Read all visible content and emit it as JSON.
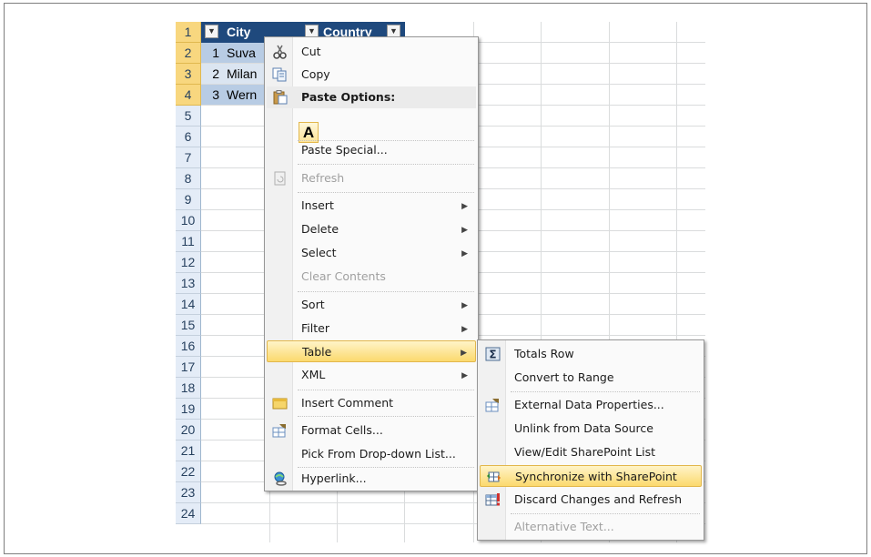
{
  "sheet": {
    "row_numbers": [
      "1",
      "2",
      "3",
      "4",
      "5",
      "6",
      "7",
      "8",
      "9",
      "10",
      "11",
      "12",
      "13",
      "14",
      "15",
      "16",
      "17",
      "18",
      "19",
      "20",
      "21",
      "22",
      "23",
      "24"
    ],
    "table_headers": [
      "City",
      "Country"
    ],
    "rows": [
      {
        "id": "1",
        "city": "Suva"
      },
      {
        "id": "2",
        "city": "Milan"
      },
      {
        "id": "3",
        "city": "Wern"
      }
    ]
  },
  "context_menu": {
    "items": [
      {
        "key": "cut",
        "label": "Cut",
        "icon": "scissors-icon"
      },
      {
        "key": "copy",
        "label": "Copy",
        "icon": "copy-icon"
      },
      {
        "key": "paste_options",
        "label": "Paste Options:",
        "icon": "clipboard-icon",
        "header": true
      },
      {
        "key": "paste_special",
        "label": "Paste Special..."
      },
      {
        "key": "refresh",
        "label": "Refresh",
        "icon": "refresh-icon",
        "disabled": true
      },
      {
        "key": "insert",
        "label": "Insert",
        "submenu": true
      },
      {
        "key": "delete",
        "label": "Delete",
        "submenu": true
      },
      {
        "key": "select",
        "label": "Select",
        "submenu": true
      },
      {
        "key": "clear_contents",
        "label": "Clear Contents",
        "disabled": true
      },
      {
        "key": "sort",
        "label": "Sort",
        "submenu": true
      },
      {
        "key": "filter",
        "label": "Filter",
        "submenu": true
      },
      {
        "key": "table",
        "label": "Table",
        "submenu": true,
        "highlighted": true
      },
      {
        "key": "xml",
        "label": "XML",
        "submenu": true
      },
      {
        "key": "insert_comment",
        "label": "Insert Comment",
        "icon": "comment-icon"
      },
      {
        "key": "format_cells",
        "label": "Format Cells...",
        "icon": "format-cells-icon"
      },
      {
        "key": "pick_list",
        "label": "Pick From Drop-down List..."
      },
      {
        "key": "hyperlink",
        "label": "Hyperlink...",
        "icon": "hyperlink-icon"
      }
    ],
    "paste_button_label": "A"
  },
  "table_submenu": {
    "items": [
      {
        "key": "totals_row",
        "label": "Totals Row",
        "icon": "sigma-icon"
      },
      {
        "key": "convert_to_range",
        "label": "Convert to Range"
      },
      {
        "key": "external_data_properties",
        "label": "External Data Properties...",
        "icon": "properties-icon"
      },
      {
        "key": "unlink",
        "label": "Unlink from Data Source"
      },
      {
        "key": "view_edit_sharepoint",
        "label": "View/Edit SharePoint List"
      },
      {
        "key": "synchronize",
        "label": "Synchronize with SharePoint",
        "icon": "sync-icon",
        "highlighted": true
      },
      {
        "key": "discard_changes",
        "label": "Discard Changes and Refresh",
        "icon": "discard-icon"
      },
      {
        "key": "alternative_text",
        "label": "Alternative Text...",
        "disabled": true
      }
    ]
  },
  "colors": {
    "table_header": "#1f497d",
    "band": "#b8cce4",
    "highlight": "#fbd96e"
  }
}
